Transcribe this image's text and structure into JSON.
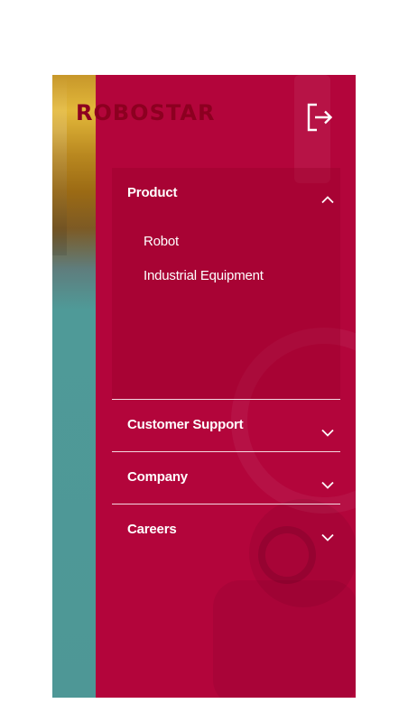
{
  "brand": {
    "logo_text": "ROBOSTAR"
  },
  "header": {
    "logout_icon": "logout-icon"
  },
  "colors": {
    "panel": "#b3053b",
    "text": "#ffffff",
    "logo": "#8c0020"
  },
  "menu": {
    "items": [
      {
        "label": "Product",
        "expanded": true,
        "chevron": "chevron-up-icon",
        "subitems": [
          "Robot",
          "Industrial Equipment"
        ]
      },
      {
        "label": "Customer Support",
        "expanded": false,
        "chevron": "chevron-down-icon"
      },
      {
        "label": "Company",
        "expanded": false,
        "chevron": "chevron-down-icon"
      },
      {
        "label": "Careers",
        "expanded": false,
        "chevron": "chevron-down-icon"
      }
    ]
  }
}
